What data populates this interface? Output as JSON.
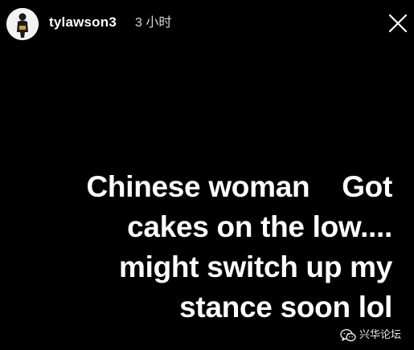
{
  "header": {
    "username": "tylawson3",
    "timestamp": "3 小时",
    "close_icon": "close-icon",
    "avatar_icon": "profile-avatar"
  },
  "story": {
    "lines": [
      "Chinese woman    Got",
      "cakes on the low....",
      "might switch up my",
      "stance soon lol"
    ]
  },
  "watermark": {
    "icon": "wechat-icon",
    "text": "兴华论坛"
  },
  "colors": {
    "background": "#000000",
    "text": "#ffffff",
    "timestamp": "#d8d8d8"
  }
}
